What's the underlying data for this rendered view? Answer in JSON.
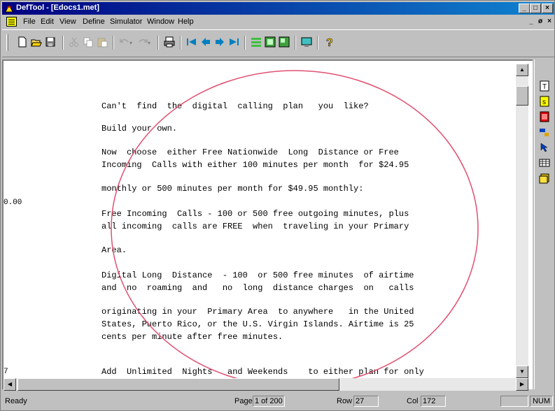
{
  "window": {
    "title": "DefTool - [Edocs1.met]",
    "caption_buttons": [
      "_",
      "□",
      "×"
    ],
    "mdi_buttons": [
      "_",
      "ø",
      "×"
    ]
  },
  "menu": {
    "items": [
      {
        "label": "File"
      },
      {
        "label": "Edit"
      },
      {
        "label": "View"
      },
      {
        "label": "Define"
      },
      {
        "label": "Simulator"
      },
      {
        "label": "Window"
      },
      {
        "label": "Help"
      }
    ]
  },
  "toolbar": {
    "groups": [
      [
        "new-document-icon",
        "open-folder-icon",
        "save-disk-icon"
      ],
      [
        "cut-scissors-icon",
        "copy-icon",
        "paste-icon"
      ],
      [
        "undo-icon",
        "redo-icon"
      ],
      [
        "print-icon"
      ],
      [
        "first-page-icon",
        "previous-page-icon",
        "next-page-icon",
        "last-page-icon"
      ],
      [
        "list-view-icon",
        "zoom-in-icon",
        "zoom-out-icon"
      ],
      [
        "display-icon"
      ],
      [
        "help-question-icon"
      ]
    ]
  },
  "document": {
    "lines": [
      "Can't  find  the  digital  calling  plan   you  like?",
      "Build your own.",
      "Now  choose  either Free Nationwide  Long  Distance or Free",
      "Incoming  Calls with either 100 minutes per month  for $24.95",
      "monthly or 500 minutes per month for $49.95 monthly:",
      "Free Incoming  Calls - 100 or 500 free outgoing minutes, plus",
      "all incoming  calls are FREE  when  traveling in your Primary",
      "Area.",
      "Digital Long  Distance  - 100  or 500 free minutes  of airtime",
      "and  no  roaming  and   no  long  distance charges  on   calls",
      "originating in your  Primary Area  to anywhere   in the United",
      "States, Puerto Rico, or the U.S. Virgin Islands. Airtime is 25",
      "cents per minute after free minutes.",
      "Add  Unlimited  Nights   and Weekends    to either plan for only"
    ],
    "margin_labels": [
      "0.00",
      "7"
    ],
    "annotation_color": "#e05070"
  },
  "palette": {
    "icons": [
      "text-block-icon",
      "yellow-field-icon",
      "red-field-icon",
      "connector-icon",
      "pointer-icon",
      "table-icon",
      "stack-icon"
    ]
  },
  "statusbar": {
    "status": "Ready",
    "page_label": "Page",
    "page_value": "1 of 200",
    "row_label": "Row",
    "row_value": "27",
    "col_label": "Col",
    "col_value": "172",
    "num_indicator": "NUM"
  }
}
